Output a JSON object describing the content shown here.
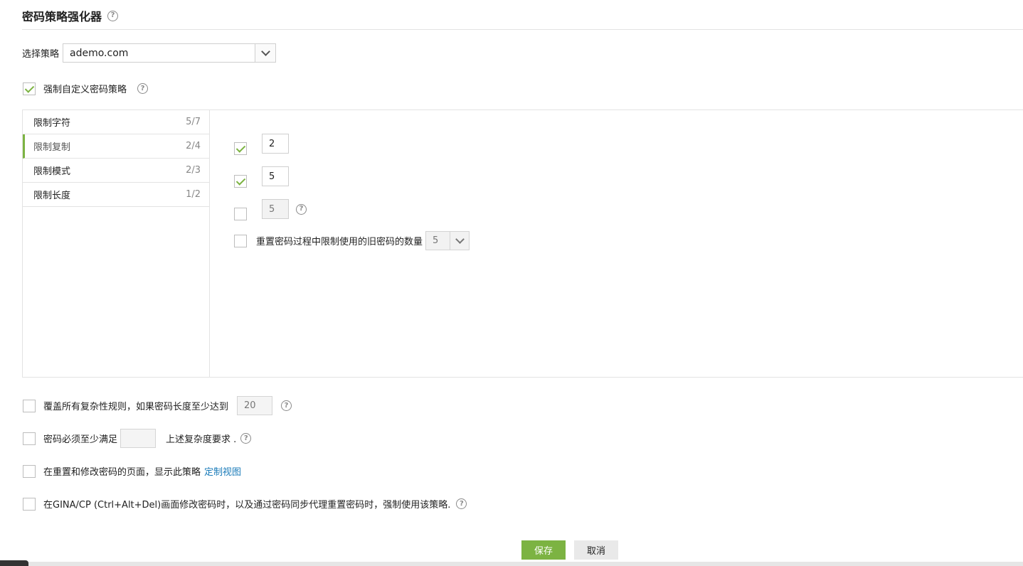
{
  "header": {
    "title": "密码策略强化器",
    "help_icon": "question-circle-icon"
  },
  "policy": {
    "label": "选择策略",
    "selected": "ademo.com"
  },
  "enforce": {
    "label": "强制自定义密码策略",
    "checked": true
  },
  "sidebar": {
    "items": [
      {
        "label": "限制字符",
        "count": "5/7",
        "active": false
      },
      {
        "label": "限制复制",
        "count": "2/4",
        "active": true
      },
      {
        "label": "限制模式",
        "count": "2/3",
        "active": false
      },
      {
        "label": "限制长度",
        "count": "1/2",
        "active": false
      }
    ]
  },
  "options": [
    {
      "checked": true,
      "value": "2",
      "disabled": false
    },
    {
      "checked": true,
      "value": "5",
      "disabled": false
    },
    {
      "checked": false,
      "value": "5",
      "disabled": true,
      "help": true
    }
  ],
  "history": {
    "label": "重置密码过程中限制使用的旧密码的数量",
    "checked": false,
    "value": "5"
  },
  "bottom_options": {
    "override": {
      "label": "覆盖所有复杂性规则，如果密码长度至少达到",
      "value": "20",
      "checked": false
    },
    "must_meet": {
      "label_before": "密码必须至少满足",
      "label_after": "上述复杂度要求 .",
      "value": "",
      "checked": false
    },
    "show_policy": {
      "label": "在重置和修改密码的页面，显示此策略",
      "link": "定制视图",
      "checked": false
    },
    "gina": {
      "label": "在GINA/CP (Ctrl+Alt+Del)画面修改密码时，以及通过密码同步代理重置密码时，强制使用该策略.",
      "checked": false
    }
  },
  "actions": {
    "save": "保存",
    "cancel": "取消"
  },
  "colors": {
    "accent": "#7cb342",
    "link": "#1a7bb9"
  }
}
